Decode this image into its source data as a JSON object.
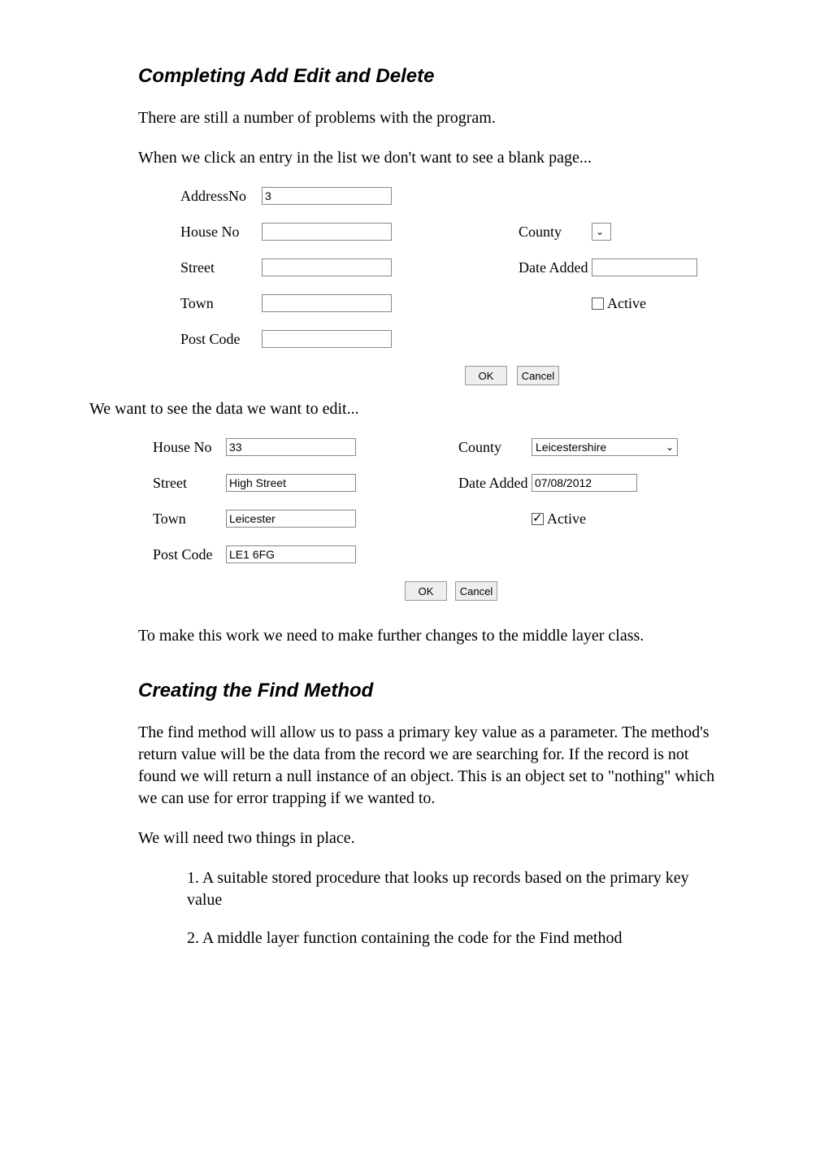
{
  "section1_title": "Completing Add Edit and Delete",
  "para1": "There are still a number of problems with the program.",
  "para2": "When we click an entry in the list we don't want to see a blank page...",
  "form1": {
    "addressNo": {
      "label": "AddressNo",
      "value": "3"
    },
    "houseNo": {
      "label": "House No",
      "value": ""
    },
    "street": {
      "label": "Street",
      "value": ""
    },
    "town": {
      "label": "Town",
      "value": ""
    },
    "postCode": {
      "label": "Post Code",
      "value": ""
    },
    "county": {
      "label": "County",
      "selected": ""
    },
    "dateAdded": {
      "label": "Date Added",
      "value": ""
    },
    "active": {
      "label": "Active",
      "checked": false
    },
    "ok": "OK",
    "cancel": "Cancel"
  },
  "para3": "We want to see the data we want to edit...",
  "form2": {
    "houseNo": {
      "label": "House No",
      "value": "33"
    },
    "street": {
      "label": "Street",
      "value": "High Street"
    },
    "town": {
      "label": "Town",
      "value": "Leicester"
    },
    "postCode": {
      "label": "Post Code",
      "value": "LE1 6FG"
    },
    "county": {
      "label": "County",
      "selected": "Leicestershire"
    },
    "dateAdded": {
      "label": "Date Added",
      "value": "07/08/2012"
    },
    "active": {
      "label": "Active",
      "checked": true
    },
    "ok": "OK",
    "cancel": "Cancel"
  },
  "para4": "To make this work we need to make further changes to the middle layer class.",
  "section2_title": "Creating the Find Method",
  "para5": "The find method will allow us to pass a primary key value as a parameter.  The method's return value will be the data from the record we are searching for.  If the record is not found we will return a null instance of an object.  This is an object set to \"nothing\" which we can use for error trapping if we wanted to.",
  "para6": "We will need two things in place.",
  "item1": "1. A suitable stored procedure that looks up records based on the primary key value",
  "item2": "2. A middle layer function containing the code for the Find method"
}
